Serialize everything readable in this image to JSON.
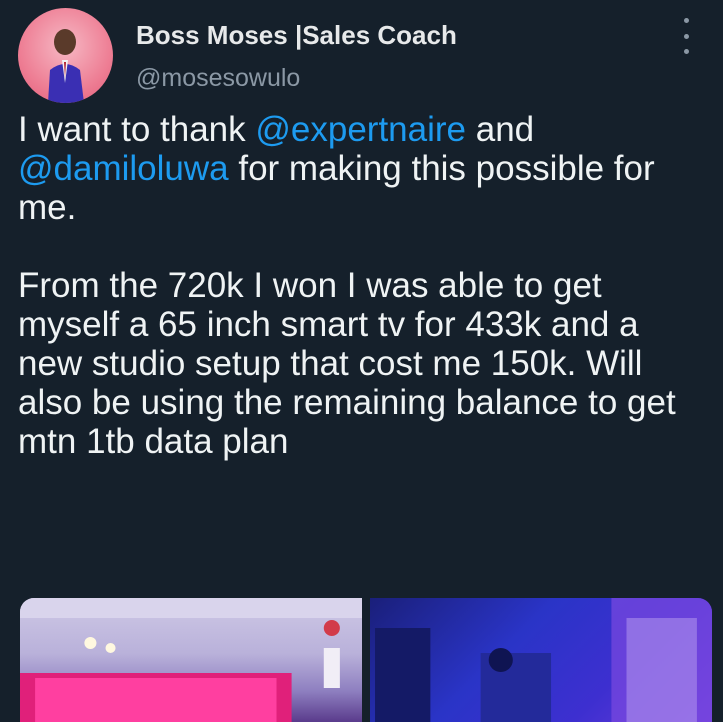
{
  "header": {
    "display_name": "Boss Moses |Sales Coach",
    "handle": "@mosesowulo",
    "more_icon": "more-vertical-icon"
  },
  "tweet": {
    "line_1_prefix": "I want to thank ",
    "mention_1": "@expertnaire",
    "line_1_suffix": " and",
    "mention_2": "@damiloluwa",
    "line_2_suffix": " for making this possible for me.",
    "paragraph_2": "From the 720k I won I was able to get myself a 65 inch smart tv for 433k and a new studio setup that cost me 150k. Will also be using the remaining balance to get mtn 1tb data plan"
  },
  "colors": {
    "background": "#15202b",
    "text": "#eff3f4",
    "secondary_text": "#8b98a5",
    "link": "#1d9bf0"
  },
  "media": {
    "count": 2,
    "items": [
      "photo-living-room-tv",
      "photo-studio-setup"
    ]
  }
}
